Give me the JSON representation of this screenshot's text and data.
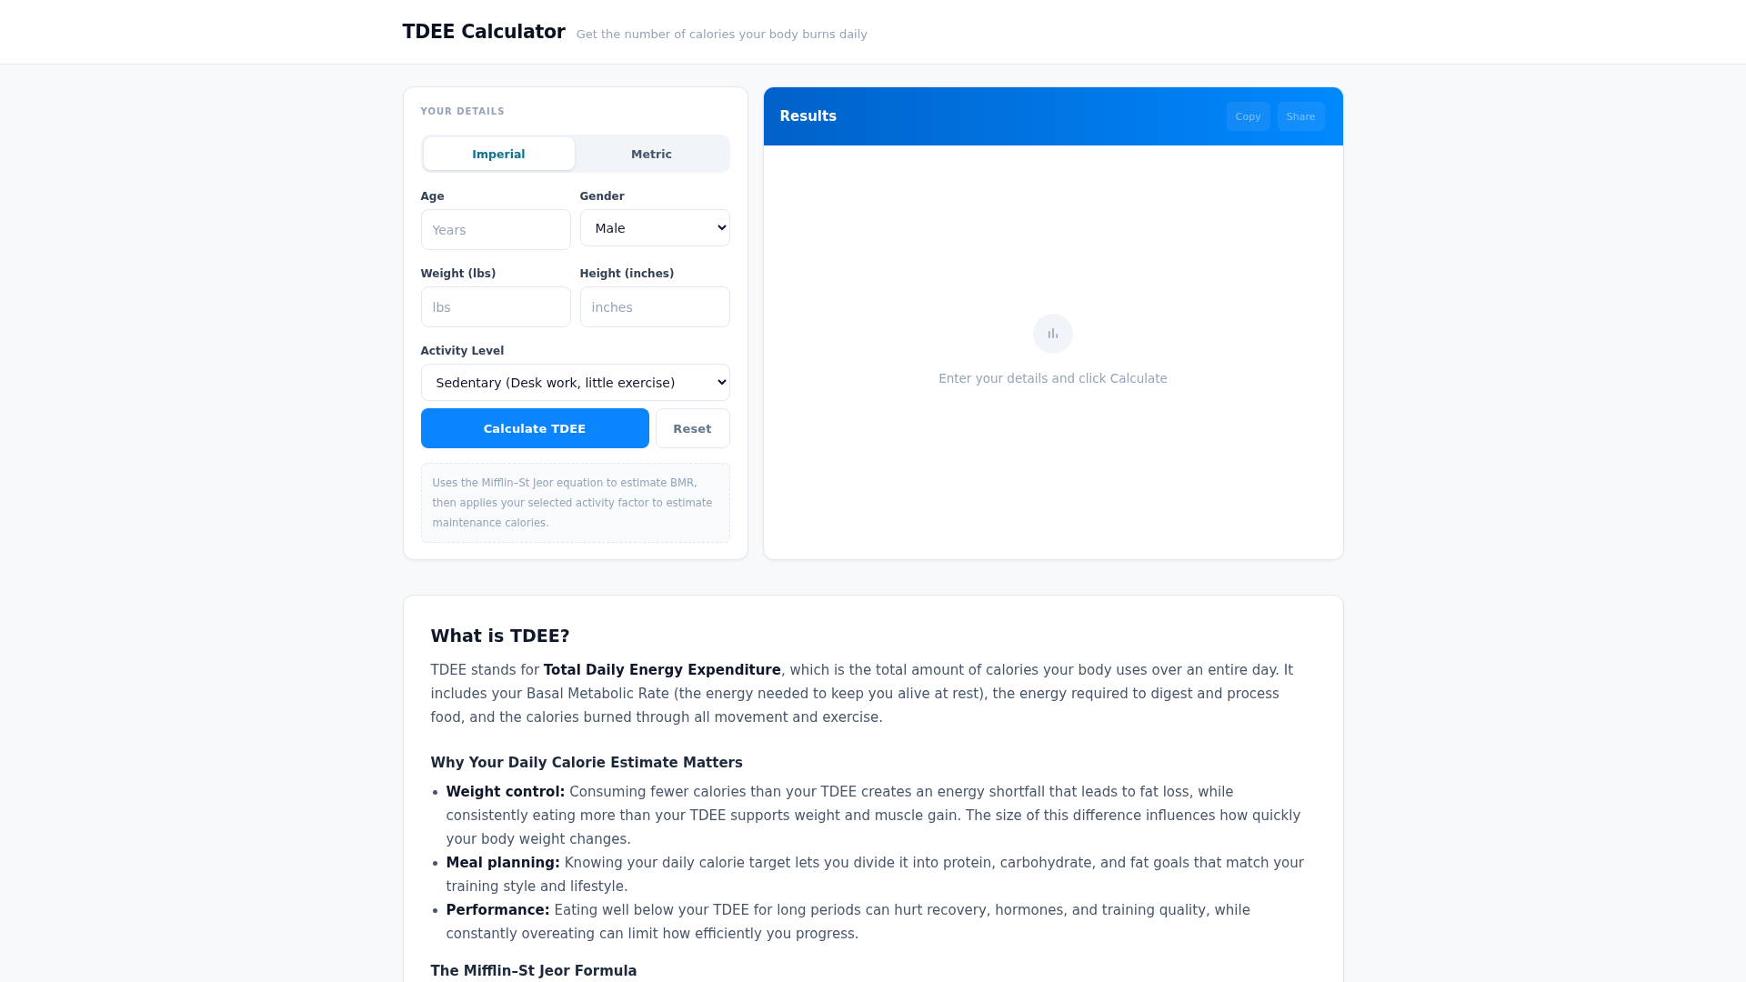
{
  "header": {
    "title": "TDEE Calculator",
    "subtitle": "Get the number of calories your body burns daily"
  },
  "details": {
    "heading": "YOUR DETAILS",
    "unit_tabs": [
      {
        "label": "Imperial",
        "selected": true
      },
      {
        "label": "Metric",
        "selected": false
      }
    ],
    "field_rows": [
      {
        "fields": [
          {
            "kind": "input",
            "label": "Age",
            "placeholder": "Years"
          },
          {
            "kind": "select",
            "label": "Gender",
            "value": "Male"
          }
        ]
      },
      {
        "fields": [
          {
            "kind": "input",
            "label": "Weight (lbs)",
            "placeholder": "lbs"
          },
          {
            "kind": "input",
            "label": "Height (inches)",
            "placeholder": "inches"
          }
        ]
      },
      {
        "fields": [
          {
            "kind": "select",
            "label": "Activity Level",
            "value": "Sedentary (Desk work, little exercise)"
          }
        ]
      }
    ],
    "buttons": [
      {
        "kind": "primary",
        "label": "Calculate TDEE"
      },
      {
        "kind": "secondary",
        "label": "Reset"
      }
    ],
    "note": "Uses the Mifflin–St Jeor equation to estimate BMR, then applies your selected activity factor to estimate maintenance calories."
  },
  "results": {
    "title": "Results",
    "actions": [
      {
        "label": "Copy",
        "disabled": true
      },
      {
        "label": "Share",
        "disabled": true
      }
    ],
    "empty_message": "Enter your details and click Calculate"
  },
  "info": {
    "title": "What is TDEE?",
    "intro": "TDEE stands for **Total Daily Energy Expenditure**, which is the total amount of calories your body uses over an entire day. It includes your Basal Metabolic Rate (the energy needed to keep you alive at rest), the energy required to digest and process food, and the calories burned through all movement and exercise.",
    "sections": [
      {
        "heading": "Why Your Daily Calorie Estimate Matters",
        "bullets": [
          "**Weight control:** Consuming fewer calories than your TDEE creates an energy shortfall that leads to fat loss, while consistently eating more than your TDEE supports weight and muscle gain. The size of this difference influences how quickly your body weight changes.",
          "**Meal planning:** Knowing your daily calorie target lets you divide it into protein, carbohydrate, and fat goals that match your training style and lifestyle.",
          "**Performance:** Eating well below your TDEE for long periods can hurt recovery, hormones, and training quality, while constantly overeating can limit how efficiently you progress."
        ]
      },
      {
        "heading": "The Mifflin–St Jeor Formula"
      }
    ]
  }
}
